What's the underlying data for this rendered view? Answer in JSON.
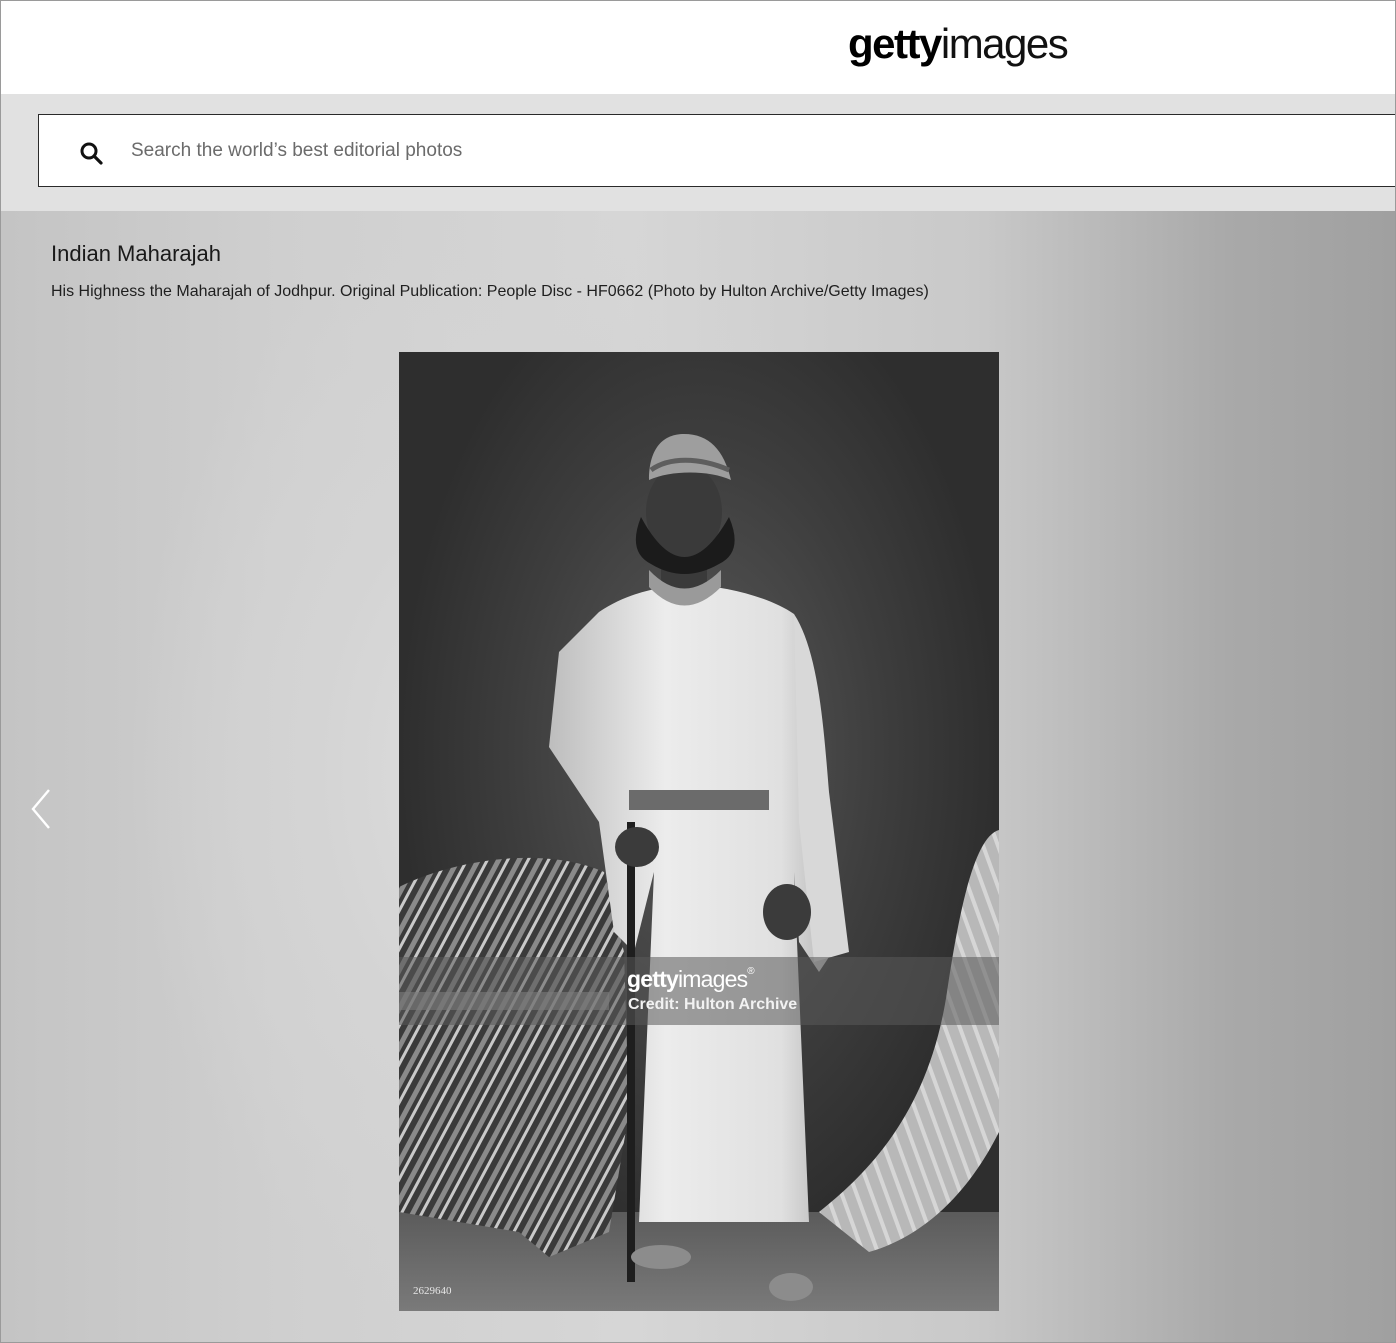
{
  "header": {
    "logo_bold": "getty",
    "logo_light": "images"
  },
  "search": {
    "placeholder": "Search the world’s best editorial photos",
    "icon": "search-icon"
  },
  "image": {
    "title": "Indian Maharajah",
    "caption": "His Highness the Maharajah of Jodhpur. Original Publication: People Disc - HF0662 (Photo by Hulton Archive/Getty Images)",
    "watermark_logo_bold": "getty",
    "watermark_logo_light": "images",
    "watermark_mark": "®",
    "watermark_credit": "Credit: Hulton Archive",
    "image_id": "2629640"
  },
  "nav": {
    "prev_icon": "chevron-left-icon"
  }
}
